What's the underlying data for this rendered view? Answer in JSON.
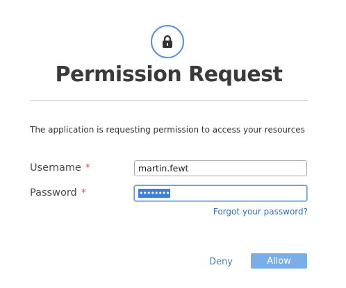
{
  "header": {
    "icon": "lock-icon",
    "title": "Permission Request"
  },
  "form": {
    "description": "The application is requesting permission to access your resources",
    "username": {
      "label": "Username",
      "required_marker": "*",
      "value": "martin.fewt"
    },
    "password": {
      "label": "Password",
      "required_marker": "*",
      "masked_value": "••••••••"
    },
    "forgot_link": "Forgot your password?"
  },
  "actions": {
    "deny_label": "Deny",
    "allow_label": "Allow"
  },
  "colors": {
    "accent": "#5b8fd4",
    "allow_button": "#7aaee8",
    "link": "#2f6fb5",
    "required": "#d9534f"
  }
}
